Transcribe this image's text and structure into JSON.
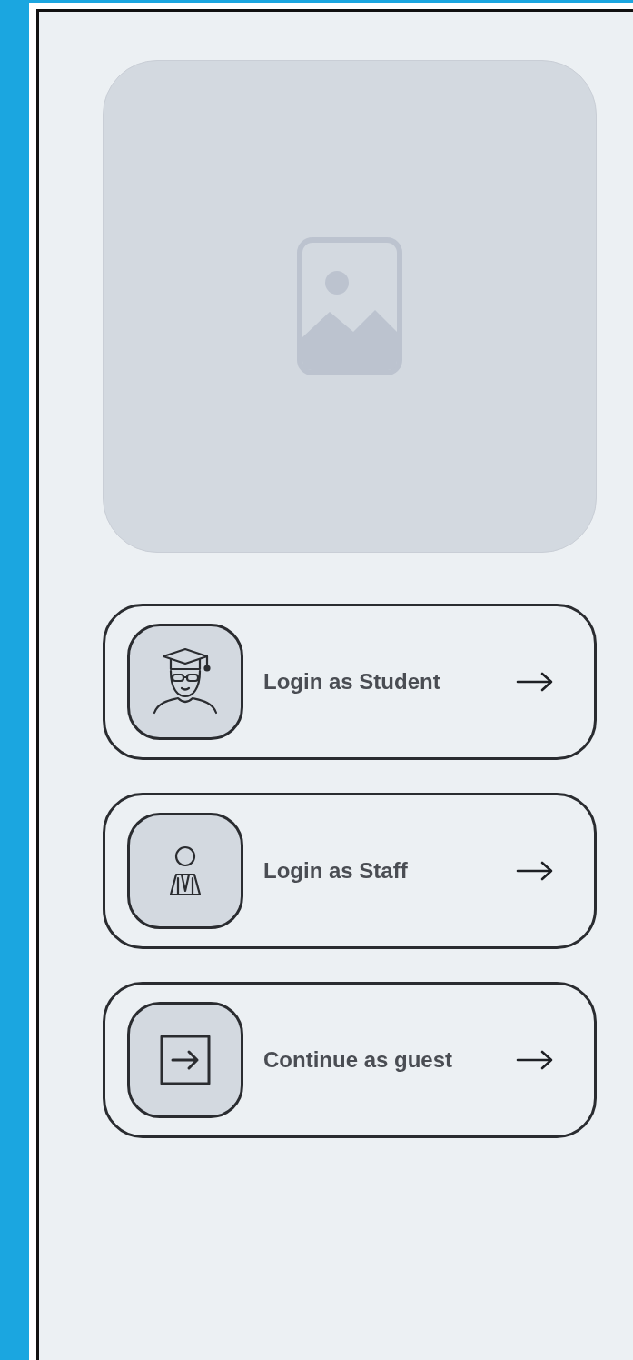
{
  "hero_image": {
    "kind": "placeholder"
  },
  "options": [
    {
      "kind": "student",
      "label": "Login as Student"
    },
    {
      "kind": "staff",
      "label": "Login as Staff"
    },
    {
      "kind": "guest",
      "label": "Continue as guest"
    }
  ]
}
